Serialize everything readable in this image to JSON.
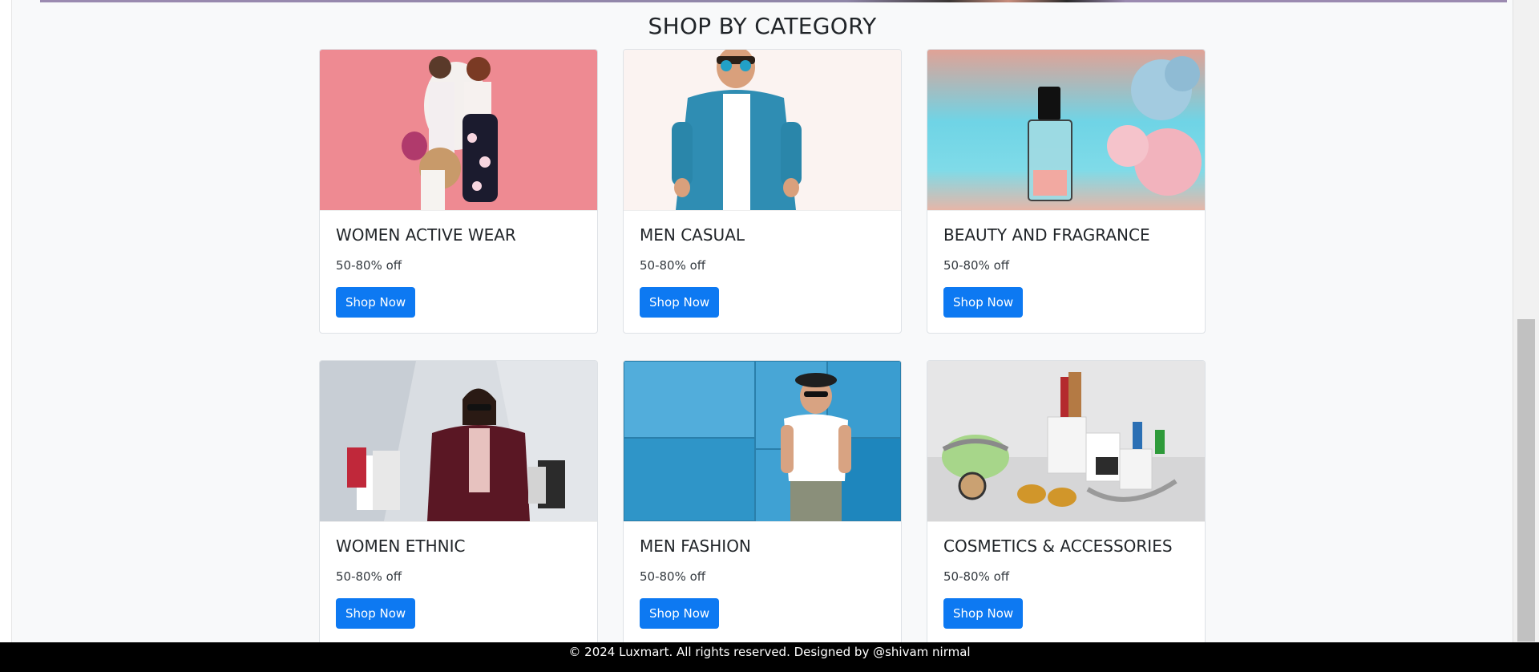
{
  "section": {
    "title": "SHOP BY CATEGORY"
  },
  "categories": [
    {
      "title": "WOMEN ACTIVE WEAR",
      "offer": "50-80% off",
      "button": "Shop Now",
      "image": "women-active-wear-photo"
    },
    {
      "title": "MEN CASUAL",
      "offer": "50-80% off",
      "button": "Shop Now",
      "image": "men-casual-photo"
    },
    {
      "title": "BEAUTY AND FRAGRANCE",
      "offer": "50-80% off",
      "button": "Shop Now",
      "image": "perfume-photo"
    },
    {
      "title": "WOMEN ETHNIC",
      "offer": "50-80% off",
      "button": "Shop Now",
      "image": "women-ethnic-photo"
    },
    {
      "title": "MEN FASHION",
      "offer": "50-80% off",
      "button": "Shop Now",
      "image": "men-fashion-photo"
    },
    {
      "title": "COSMETICS & ACCESSORIES",
      "offer": "50-80% off",
      "button": "Shop Now",
      "image": "cosmetics-photo"
    }
  ],
  "footer": {
    "text": "© 2024 Luxmart. All rights reserved. Designed by @shivam nirmal"
  },
  "colors": {
    "button": "#0d79f2",
    "footer_bg": "#000000",
    "page_bg": "#f8f9fa"
  }
}
